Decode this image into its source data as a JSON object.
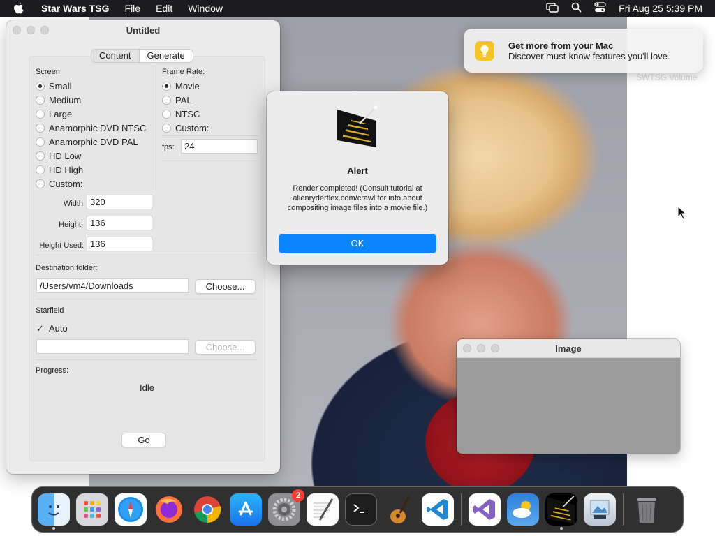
{
  "menubar": {
    "app_name": "Star Wars TSG",
    "menus": [
      "File",
      "Edit",
      "Window"
    ],
    "clock": "Fri Aug 25  5:39 PM"
  },
  "notification": {
    "title": "Get more from your Mac",
    "body": "Discover must-know features you'll love.",
    "icon": "lightbulb-icon"
  },
  "desktop": {
    "volume_label": "SWTSG Volume"
  },
  "main_window": {
    "title": "Untitled",
    "tabs": [
      "Content",
      "Generate"
    ],
    "active_tab": "Generate",
    "screen": {
      "label": "Screen",
      "options": [
        "Small",
        "Medium",
        "Large",
        "Anamorphic DVD NTSC",
        "Anamorphic DVD PAL",
        "HD Low",
        "HD High",
        "Custom:"
      ],
      "selected": "Small",
      "width_label": "Width",
      "width_value": "320",
      "height_label": "Height:",
      "height_value": "136",
      "height_used_label": "Height Used:",
      "height_used_value": "136"
    },
    "frame_rate": {
      "label": "Frame Rate:",
      "options": [
        "Movie",
        "PAL",
        "NTSC",
        "Custom:"
      ],
      "selected": "Movie",
      "fps_label": "fps:",
      "fps_value": "24"
    },
    "destination": {
      "label": "Destination folder:",
      "value": "/Users/vm4/Downloads",
      "choose_label": "Choose..."
    },
    "starfield": {
      "label": "Starfield",
      "auto_label": "Auto",
      "auto_checked": true,
      "value": "",
      "choose_label": "Choose..."
    },
    "progress": {
      "label": "Progress:",
      "status": "Idle"
    },
    "go_label": "Go"
  },
  "alert": {
    "title": "Alert",
    "message": "Render completed!  (Consult tutorial at alienryderflex.com/crawl for info about compositing image files into a movie file.)",
    "ok_label": "OK"
  },
  "image_window": {
    "title": "Image"
  },
  "dock": {
    "items": [
      {
        "name": "finder",
        "running": true
      },
      {
        "name": "launchpad",
        "running": false
      },
      {
        "name": "safari",
        "running": false
      },
      {
        "name": "firefox",
        "running": false
      },
      {
        "name": "chrome",
        "running": false
      },
      {
        "name": "app-store",
        "running": false
      },
      {
        "name": "system-settings",
        "running": false,
        "badge": "2"
      },
      {
        "name": "textedit",
        "running": false
      },
      {
        "name": "terminal",
        "running": false
      },
      {
        "name": "garageband",
        "running": false
      },
      {
        "name": "vscode",
        "running": false
      }
    ],
    "recent_items": [
      {
        "name": "visual-studio",
        "running": false
      },
      {
        "name": "weather",
        "running": false
      },
      {
        "name": "star-wars-tsg",
        "running": true
      },
      {
        "name": "preview",
        "running": false
      }
    ],
    "trash": {
      "name": "trash"
    }
  },
  "colors": {
    "accent": "#0a84ff",
    "menubar": "#1c1c1e",
    "badge": "#ff3b30",
    "window_bg": "#ececec"
  }
}
